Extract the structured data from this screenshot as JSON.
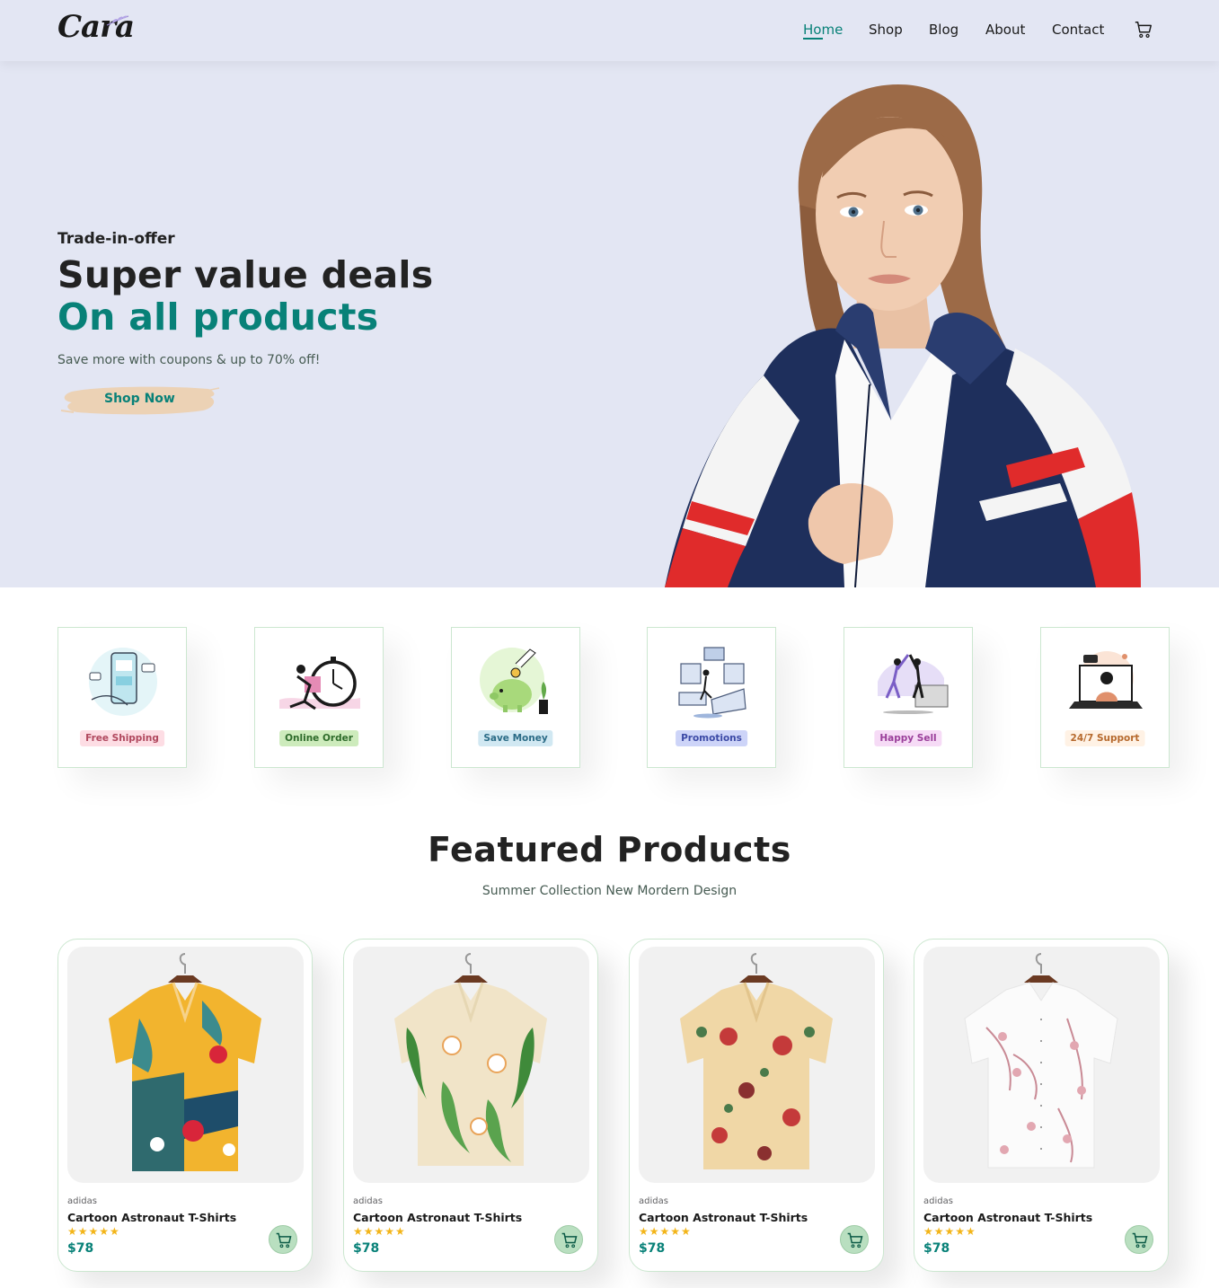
{
  "header": {
    "logo": "Cara",
    "nav": [
      {
        "label": "Home",
        "active": true
      },
      {
        "label": "Shop",
        "active": false
      },
      {
        "label": "Blog",
        "active": false
      },
      {
        "label": "About",
        "active": false
      },
      {
        "label": "Contact",
        "active": false
      }
    ],
    "cart_icon": "cart-icon"
  },
  "hero": {
    "eyebrow": "Trade-in-offer",
    "title_line1": "Super value deals",
    "title_line2": "On all products",
    "subtitle": "Save more with coupons & up to 70% off!",
    "cta": "Shop Now"
  },
  "features": [
    {
      "label": "Free Shipping",
      "bg": "#fddde4",
      "fg": "#b0485e"
    },
    {
      "label": "Online Order",
      "bg": "#cdebbc",
      "fg": "#2e6b2b"
    },
    {
      "label": "Save Money",
      "bg": "#d1e8f2",
      "fg": "#2b6b86"
    },
    {
      "label": "Promotions",
      "bg": "#cdd4f8",
      "fg": "#3c4aa6"
    },
    {
      "label": "Happy Sell",
      "bg": "#f6dbf6",
      "fg": "#9a3f9a"
    },
    {
      "label": "24/7 Support",
      "bg": "#fff2e5",
      "fg": "#b6692d"
    }
  ],
  "featured": {
    "title": "Featured Products",
    "subtitle": "Summer Collection New Mordern Design"
  },
  "products": [
    {
      "brand": "adidas",
      "name": "Cartoon Astronaut T-Shirts",
      "rating": 5,
      "stars": "★★★★★",
      "price": "$78"
    },
    {
      "brand": "adidas",
      "name": "Cartoon Astronaut T-Shirts",
      "rating": 5,
      "stars": "★★★★★",
      "price": "$78"
    },
    {
      "brand": "adidas",
      "name": "Cartoon Astronaut T-Shirts",
      "rating": 5,
      "stars": "★★★★★",
      "price": "$78"
    },
    {
      "brand": "adidas",
      "name": "Cartoon Astronaut T-Shirts",
      "rating": 5,
      "stars": "★★★★★",
      "price": "$78"
    }
  ],
  "colors": {
    "accent": "#088178",
    "hero_bg": "#e3e6f3",
    "star": "#f3b519"
  }
}
